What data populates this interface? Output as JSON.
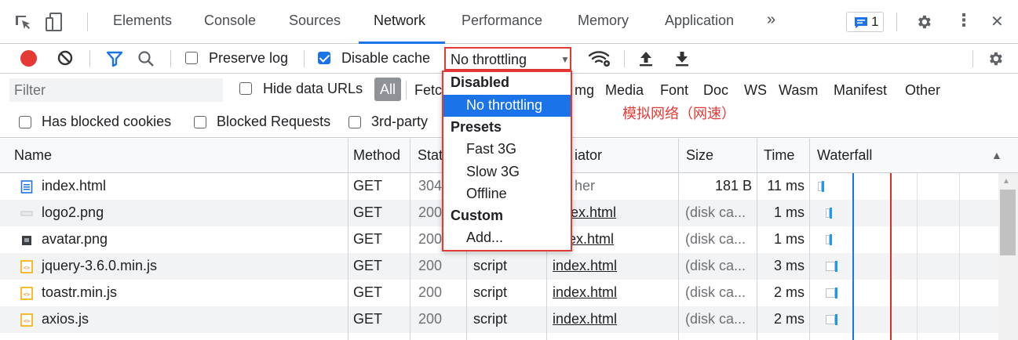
{
  "tabs": {
    "elements": "Elements",
    "console": "Console",
    "sources": "Sources",
    "network": "Network",
    "performance": "Performance",
    "memory": "Memory",
    "application": "Application",
    "more": "»",
    "issues_count": "1",
    "kebab": "⋮",
    "close": "✕"
  },
  "toolbar": {
    "preserve_log": "Preserve log",
    "disable_cache": "Disable cache",
    "throttling_value": "No throttling",
    "throttling_arrow": "▼"
  },
  "filter": {
    "placeholder": "Filter",
    "hide_data_urls": "Hide data URLs",
    "all": "All",
    "fetch_partial": "Fetc",
    "img_partial": "mg",
    "media": "Media",
    "font": "Font",
    "doc": "Doc",
    "ws": "WS",
    "wasm": "Wasm",
    "manifest": "Manifest",
    "other": "Other",
    "has_blocked_cookies": "Has blocked cookies",
    "blocked_requests": "Blocked Requests",
    "third_party": "3rd-party"
  },
  "annotation": "模拟网络（网速）",
  "dropdown": {
    "disabled": "Disabled",
    "no_throttling": "No throttling",
    "presets": "Presets",
    "fast3g": "Fast 3G",
    "slow3g": "Slow 3G",
    "offline": "Offline",
    "custom": "Custom",
    "add": "Add..."
  },
  "table": {
    "headers": {
      "name": "Name",
      "method": "Method",
      "status": "Stat",
      "initiator": "iator",
      "size": "Size",
      "time": "Time",
      "waterfall": "Waterfall",
      "sort": "▲"
    },
    "rows": [
      {
        "name": "index.html",
        "method": "GET",
        "status": "304",
        "type": "",
        "initiator": "her",
        "size": "181 B",
        "time": "11 ms"
      },
      {
        "name": "logo2.png",
        "method": "GET",
        "status": "200",
        "type": "",
        "initiator": "dex.html",
        "size": "(disk ca...",
        "time": "1 ms"
      },
      {
        "name": "avatar.png",
        "method": "GET",
        "status": "200",
        "type": "",
        "initiator": "ex.html",
        "size": "(disk ca...",
        "time": "1 ms"
      },
      {
        "name": "jquery-3.6.0.min.js",
        "method": "GET",
        "status": "200",
        "type": "script",
        "initiator": "index.html",
        "size": "(disk ca...",
        "time": "3 ms"
      },
      {
        "name": "toastr.min.js",
        "method": "GET",
        "status": "200",
        "type": "script",
        "initiator": "index.html",
        "size": "(disk ca...",
        "time": "2 ms"
      },
      {
        "name": "axios.js",
        "method": "GET",
        "status": "200",
        "type": "script",
        "initiator": "index.html",
        "size": "(disk ca...",
        "time": "2 ms"
      }
    ]
  },
  "colors": {
    "accent": "#1a73e8",
    "record": "#e53935",
    "highlight": "#e53935"
  }
}
